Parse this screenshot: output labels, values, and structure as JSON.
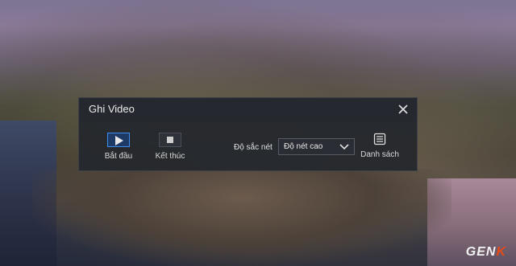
{
  "dialog": {
    "title": "Ghi Video",
    "close_icon": "close-icon"
  },
  "toolbar": {
    "start_label": "Bắt đầu",
    "start_icon": "play-icon",
    "stop_label": "Kết thúc",
    "stop_icon": "stop-icon",
    "quality_label": "Độ sắc nét",
    "quality_value": "Độ nét cao",
    "quality_chevron_icon": "chevron-down-icon",
    "list_label": "Danh sách",
    "list_icon": "list-icon"
  },
  "watermark": {
    "text_main": "GEN",
    "text_accent": "K"
  },
  "colors": {
    "accent": "#3d8cf0",
    "dialog_bg": "#24272d",
    "watermark_accent": "#e64a19"
  }
}
